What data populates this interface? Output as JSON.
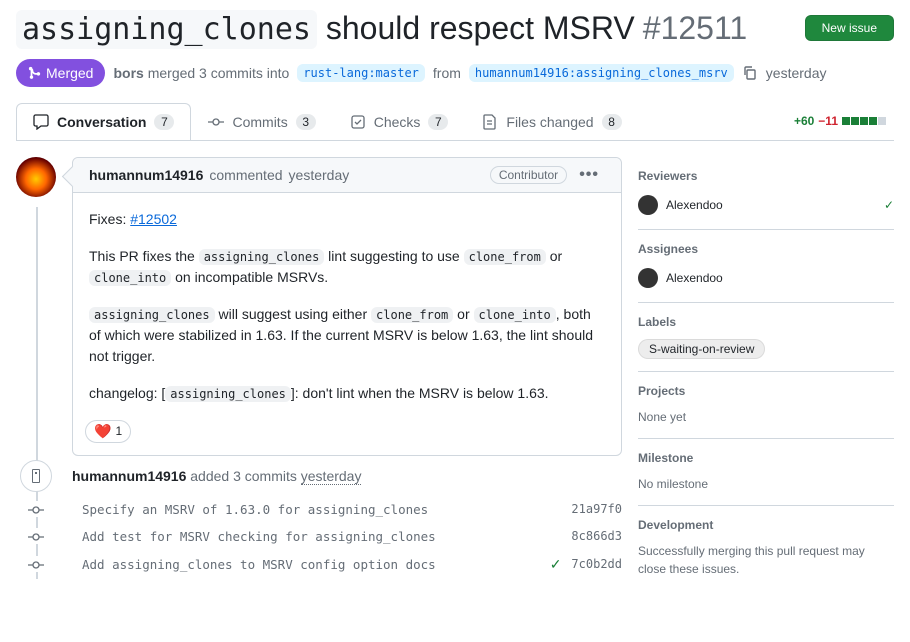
{
  "header": {
    "title_code": "assigning_clones",
    "title_rest": " should respect MSRV ",
    "pr_number": "#12511",
    "new_issue": "New issue"
  },
  "merge": {
    "state": "Merged",
    "actor": "bors",
    "text1": " merged 3 commits into ",
    "base": "rust-lang:master",
    "text2": " from ",
    "head": "humannum14916:assigning_clones_msrv",
    "when": "yesterday"
  },
  "tabs": {
    "conversation": {
      "label": "Conversation",
      "count": "7"
    },
    "commits": {
      "label": "Commits",
      "count": "3"
    },
    "checks": {
      "label": "Checks",
      "count": "7"
    },
    "files": {
      "label": "Files changed",
      "count": "8"
    },
    "diff_add": "+60",
    "diff_del": "−11"
  },
  "comment": {
    "author": "humannum14916",
    "verb": "commented ",
    "when": "yesterday",
    "role": "Contributor",
    "p1a": "Fixes: ",
    "p1_link": "#12502",
    "p2a": "This PR fixes the ",
    "p2_c1": "assigning_clones",
    "p2b": " lint suggesting to use ",
    "p2_c2": "clone_from",
    "p2c": " or ",
    "p2_c3": "clone_into",
    "p2d": " on incompatible MSRVs.",
    "p3_c1": "assigning_clones",
    "p3a": " will suggest using either ",
    "p3_c2": "clone_from",
    "p3b": " or ",
    "p3_c3": "clone_into",
    "p3c": ", both of which were stabilized in 1.63. If the current MSRV is below 1.63, the lint should not trigger.",
    "p4a": "changelog: [",
    "p4_c": "assigning_clones",
    "p4b": "]: don't lint when the MSRV is below 1.63.",
    "react_count": "1"
  },
  "timeline": {
    "added_author": "humannum14916",
    "added_text": " added 3 commits ",
    "added_when": "yesterday",
    "commits": [
      {
        "msg": "Specify an MSRV of 1.63.0 for assigning_clones",
        "sha": "21a97f0",
        "check": false
      },
      {
        "msg": "Add test for MSRV checking for assigning_clones",
        "sha": "8c866d3",
        "check": false
      },
      {
        "msg": "Add assigning_clones to MSRV config option docs",
        "sha": "7c0b2dd",
        "check": true
      }
    ]
  },
  "sidebar": {
    "reviewers": {
      "h": "Reviewers",
      "name": "Alexendoo"
    },
    "assignees": {
      "h": "Assignees",
      "name": "Alexendoo"
    },
    "labels": {
      "h": "Labels",
      "pill": "S-waiting-on-review"
    },
    "projects": {
      "h": "Projects",
      "v": "None yet"
    },
    "milestone": {
      "h": "Milestone",
      "v": "No milestone"
    },
    "dev": {
      "h": "Development",
      "v": "Successfully merging this pull request may close these issues."
    }
  }
}
